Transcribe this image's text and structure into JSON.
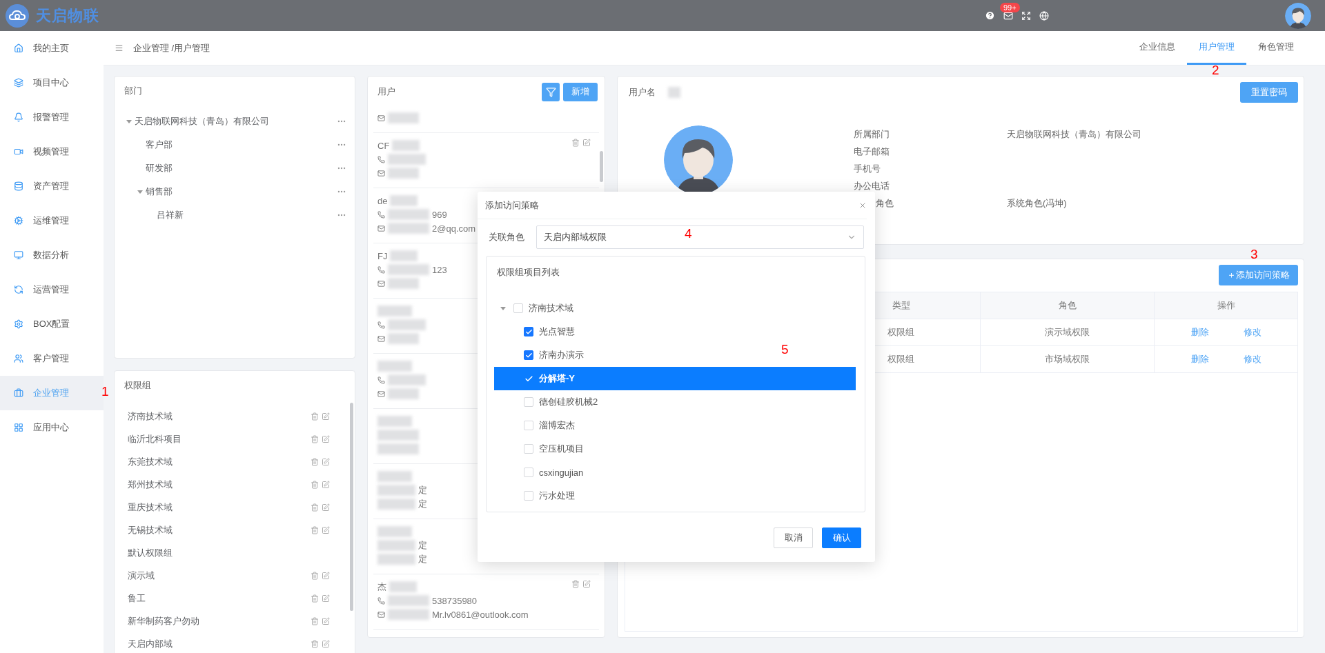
{
  "topbar": {
    "logo_text": "天启物联",
    "notification_badge": "99+"
  },
  "sidebar": {
    "items": [
      {
        "label": "我的主页",
        "selected": false
      },
      {
        "label": "项目中心",
        "selected": false
      },
      {
        "label": "报警管理",
        "selected": false
      },
      {
        "label": "视频管理",
        "selected": false
      },
      {
        "label": "资产管理",
        "selected": false
      },
      {
        "label": "运维管理",
        "selected": false
      },
      {
        "label": "数据分析",
        "selected": false
      },
      {
        "label": "运营管理",
        "selected": false
      },
      {
        "label": "BOX配置",
        "selected": false
      },
      {
        "label": "客户管理",
        "selected": false
      },
      {
        "label": "企业管理",
        "selected": true
      },
      {
        "label": "应用中心",
        "selected": false
      }
    ]
  },
  "breadcrumb": "企业管理 /用户管理",
  "tabs": [
    {
      "label": "企业信息",
      "selected": false
    },
    {
      "label": "用户管理",
      "selected": true
    },
    {
      "label": "角色管理",
      "selected": false
    }
  ],
  "departments": {
    "title": "部门",
    "tree": [
      {
        "label": "天启物联网科技（青岛）有限公司",
        "expanded": true,
        "children": [
          {
            "label": "客户部"
          },
          {
            "label": "研发部"
          },
          {
            "label": "销售部",
            "expanded": true,
            "children": [
              {
                "label": "吕祥新"
              }
            ]
          }
        ]
      }
    ]
  },
  "permission_groups": {
    "title": "权限组",
    "items": [
      {
        "label": "济南技术域",
        "actions": true
      },
      {
        "label": "临沂北科项目",
        "actions": true
      },
      {
        "label": "东莞技术域",
        "actions": true
      },
      {
        "label": "郑州技术域",
        "actions": true
      },
      {
        "label": "重庆技术域",
        "actions": true
      },
      {
        "label": "无锡技术域",
        "actions": true
      },
      {
        "label": "默认权限组",
        "actions": false
      },
      {
        "label": "演示域",
        "actions": true
      },
      {
        "label": "鲁工",
        "actions": true
      },
      {
        "label": "新华制药客户勿动",
        "actions": true
      },
      {
        "label": "天启内部域",
        "actions": true
      }
    ]
  },
  "users": {
    "title": "用户",
    "add_button": "新增",
    "items": [
      {
        "lines": [
          {
            "kind": "email"
          }
        ]
      },
      {
        "actions": true,
        "lines": [
          {
            "kind": "name",
            "text": "CF"
          },
          {
            "kind": "phone"
          },
          {
            "kind": "email"
          }
        ]
      },
      {
        "lines": [
          {
            "kind": "name",
            "text": "de"
          },
          {
            "kind": "phone",
            "text": "969"
          },
          {
            "kind": "email",
            "text": "2@qq.com"
          }
        ]
      },
      {
        "lines": [
          {
            "kind": "name",
            "text": "FJ"
          },
          {
            "kind": "phone",
            "text": "123"
          },
          {
            "kind": "email"
          }
        ]
      },
      {
        "lines": [
          {
            "kind": "name"
          },
          {
            "kind": "phone"
          },
          {
            "kind": "email"
          }
        ]
      },
      {
        "lines": [
          {
            "kind": "name"
          },
          {
            "kind": "phone"
          },
          {
            "kind": "email"
          }
        ]
      },
      {
        "lines": [
          {
            "kind": "name"
          },
          {
            "kind": "plain"
          },
          {
            "kind": "plain"
          }
        ]
      },
      {
        "lines": [
          {
            "kind": "name"
          },
          {
            "kind": "plain",
            "text": "定"
          },
          {
            "kind": "plain",
            "text": "定"
          }
        ]
      },
      {
        "lines": [
          {
            "kind": "name"
          },
          {
            "kind": "plain",
            "text": "定"
          },
          {
            "kind": "plain",
            "text": "定"
          }
        ]
      },
      {
        "actions": true,
        "lines": [
          {
            "kind": "name",
            "text": "杰"
          },
          {
            "kind": "phone",
            "text": "538735980"
          },
          {
            "kind": "email",
            "text": "Mr.lv0861@outlook.com"
          }
        ]
      }
    ]
  },
  "user_detail": {
    "label": "用户名",
    "reset_button": "重置密码",
    "fields": [
      {
        "label": "所属部门",
        "value": "天启物联网科技（青岛）有限公司"
      },
      {
        "label": "电子邮箱"
      },
      {
        "label": "手机号"
      },
      {
        "label": "办公电话"
      },
      {
        "label": "角色",
        "kind": "cut",
        "value": "系统角色(冯坤)"
      }
    ]
  },
  "policies": {
    "add_button": "＋添加访问策略",
    "columns": [
      "类型",
      "角色",
      "操作"
    ],
    "rows": [
      {
        "type": "权限组",
        "role": "演示域权限",
        "actions": [
          "删除",
          "修改"
        ]
      },
      {
        "type": "权限组",
        "role": "市场域权限",
        "actions": [
          "删除",
          "修改"
        ]
      }
    ]
  },
  "dialog": {
    "title": "添加访问策略",
    "role_label": "关联角色",
    "role_value": "天启内部域权限",
    "list_title": "权限组项目列表",
    "tree": [
      {
        "label": "济南技术域",
        "expanded": true,
        "checked": false,
        "children": [
          {
            "label": "光点智慧",
            "checked": true,
            "selected": false
          },
          {
            "label": "济南办演示",
            "checked": true,
            "selected": false
          },
          {
            "label": "分解塔-Y",
            "checked": true,
            "selected": true
          },
          {
            "label": "德创硅胶机械2",
            "checked": false,
            "selected": false
          },
          {
            "label": "淄博宏杰",
            "checked": false,
            "selected": false
          },
          {
            "label": "空压机项目",
            "checked": false,
            "selected": false
          },
          {
            "label": "csxingujian",
            "checked": false,
            "selected": false
          },
          {
            "label": "污水处理",
            "checked": false,
            "selected": false
          }
        ]
      }
    ],
    "buttons": [
      {
        "label": "取消",
        "primary": false
      },
      {
        "label": "确认",
        "primary": true
      }
    ]
  },
  "annotations": [
    {
      "text": "1"
    },
    {
      "text": "2"
    },
    {
      "text": "3"
    },
    {
      "text": "4"
    },
    {
      "text": "5"
    }
  ]
}
